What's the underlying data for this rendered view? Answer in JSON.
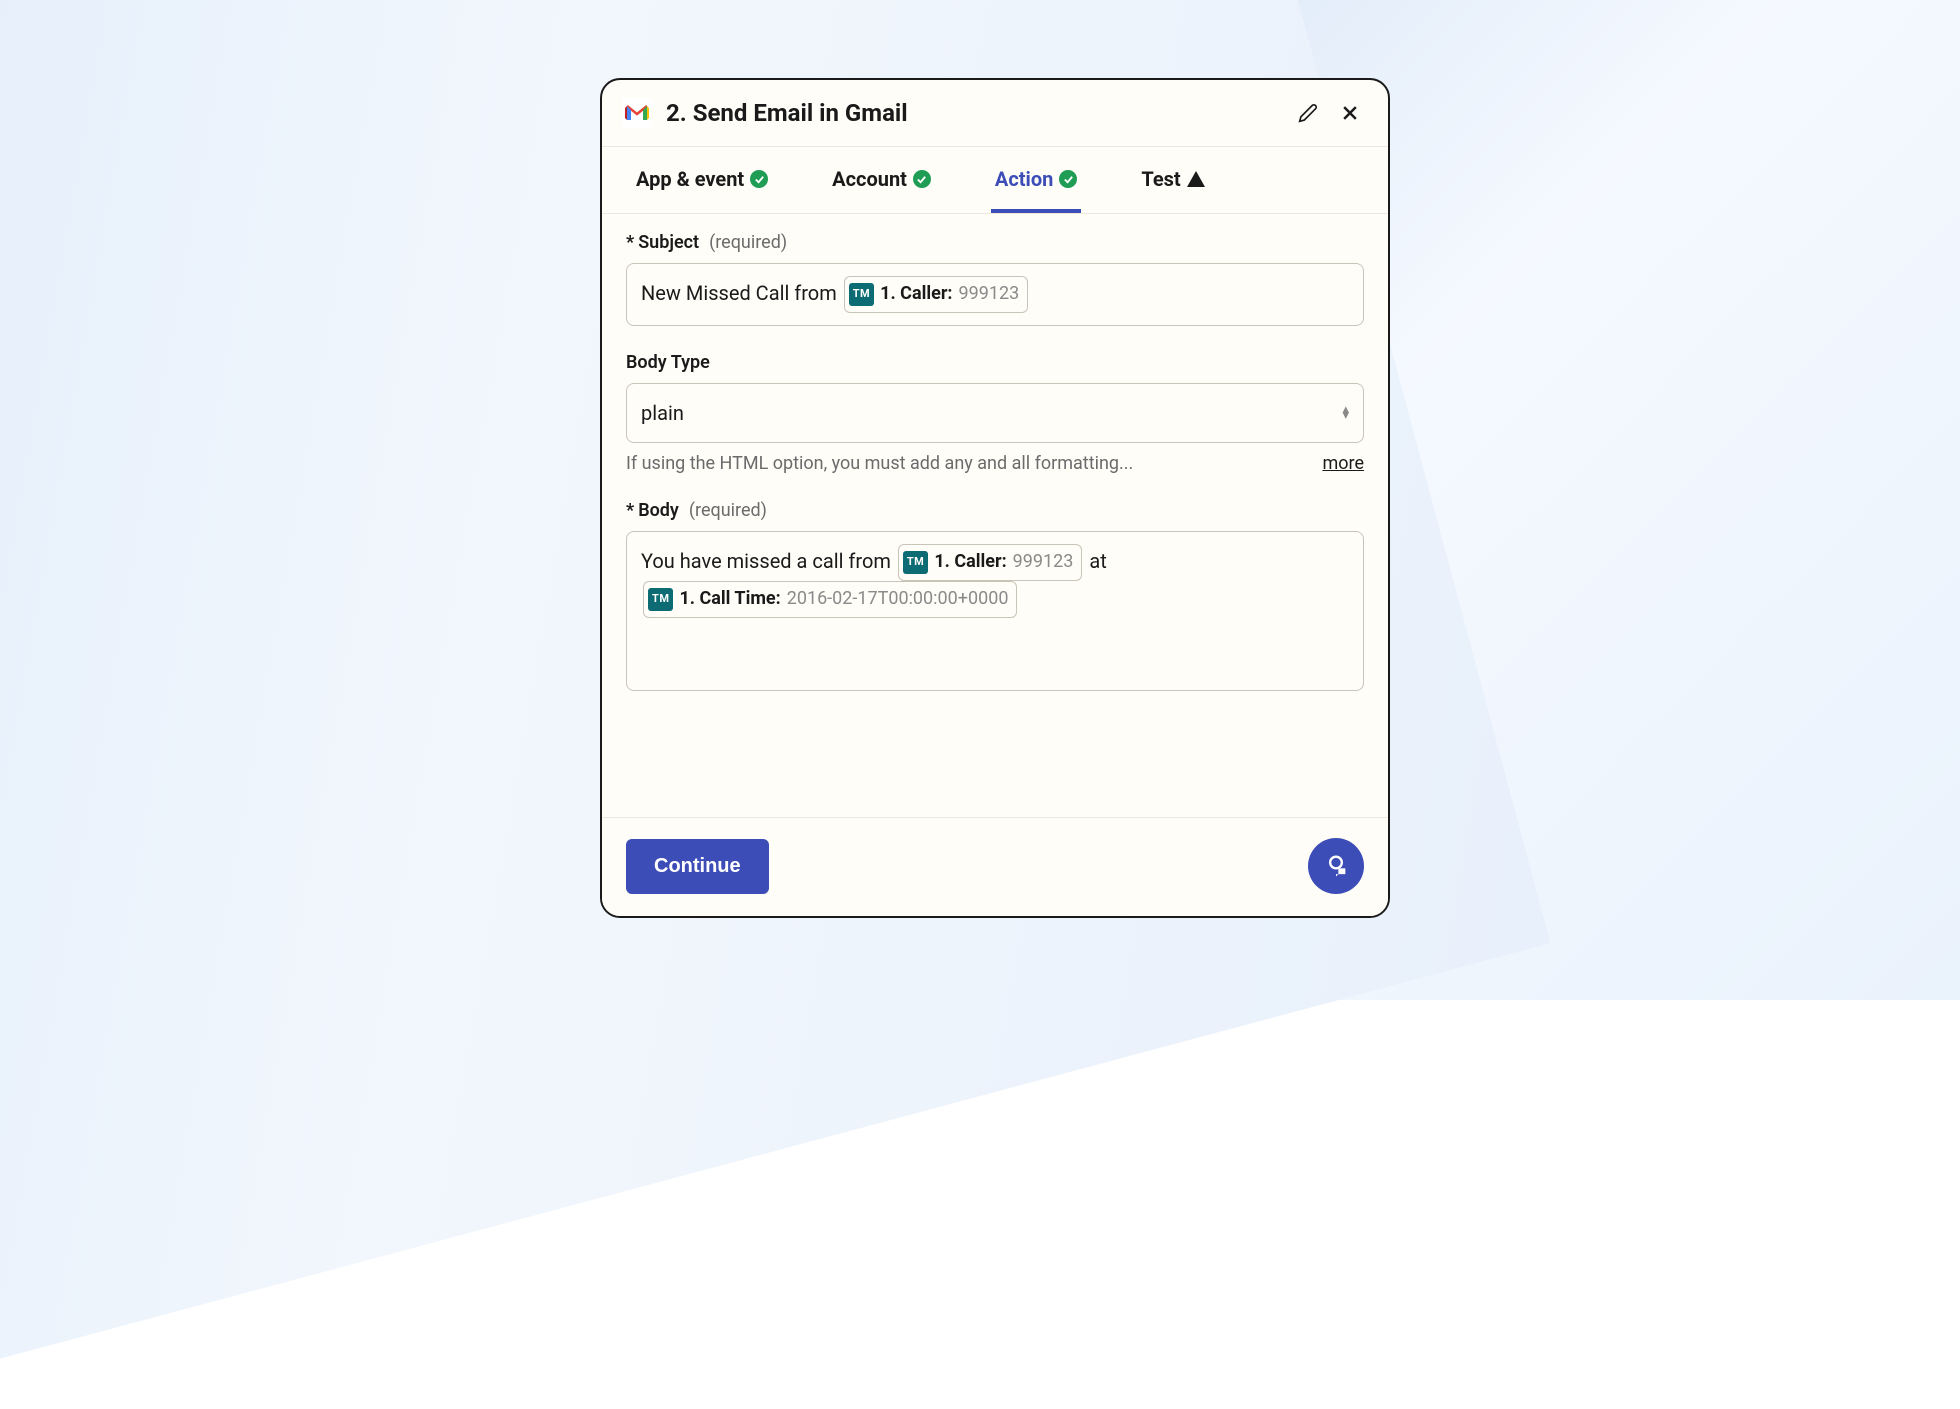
{
  "header": {
    "title": "2. Send Email in Gmail"
  },
  "tabs": {
    "app_event": "App & event",
    "account": "Account",
    "action": "Action",
    "test": "Test"
  },
  "fields": {
    "subject": {
      "label": "Subject",
      "required_hint": "(required)",
      "text_prefix": "New Missed Call from ",
      "pill1_badge": "TM",
      "pill1_label": "1. Caller:",
      "pill1_value": "999123"
    },
    "body_type": {
      "label": "Body Type",
      "value": "plain",
      "help": "If using the HTML option, you must add any and all formatting...",
      "more": "more"
    },
    "body": {
      "label": "Body",
      "required_hint": "(required)",
      "seg1": "You have missed a call from ",
      "pill1_badge": "TM",
      "pill1_label": "1. Caller:",
      "pill1_value": "999123",
      "seg2": " at ",
      "pill2_badge": "TM",
      "pill2_label": "1. Call Time:",
      "pill2_value": "2016-02-17T00:00:00+0000"
    }
  },
  "footer": {
    "continue": "Continue"
  }
}
